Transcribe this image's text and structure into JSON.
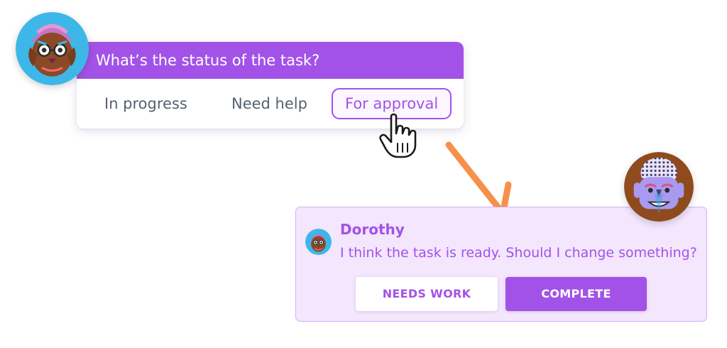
{
  "poll": {
    "question": "What’s the status of the task?",
    "options": [
      "In progress",
      "Need help",
      "For approval"
    ],
    "selected": "For approval"
  },
  "reply": {
    "author": "Dorothy",
    "message": "I think the task is ready. Should I change something?",
    "buttons": {
      "needs_work": "NEEDS WORK",
      "complete": "COMPLETE"
    }
  },
  "colors": {
    "accent": "#a352e8",
    "card_bg": "#f3e6fd",
    "arrow": "#f7904a",
    "option_text": "#56616e"
  },
  "icons": [
    "hand-pointer-cursor-icon",
    "curved-arrow-icon"
  ]
}
